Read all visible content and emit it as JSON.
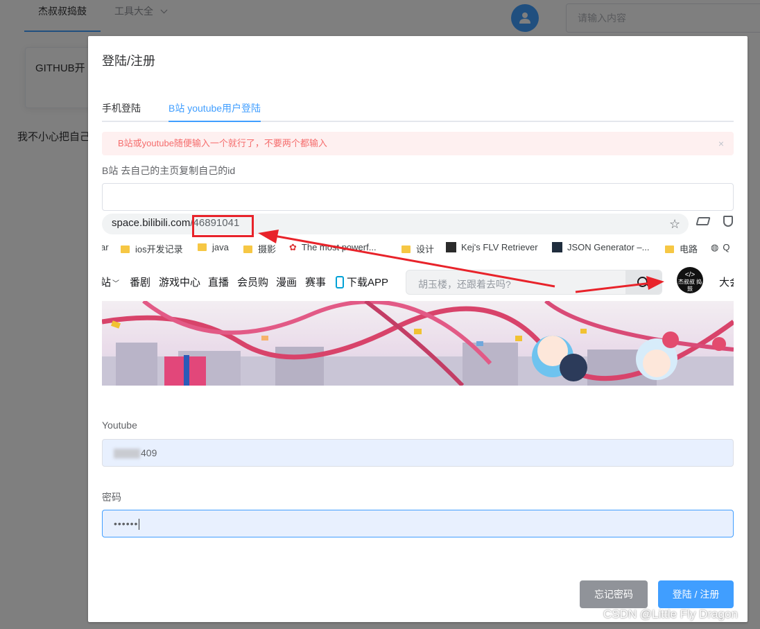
{
  "background": {
    "nav": {
      "home": "杰叔叔捣鼓",
      "tools": "工具大全"
    },
    "search_placeholder": "请输入内容",
    "card_title": "GITHUB开",
    "text": "我不小心把自己"
  },
  "dialog": {
    "title": "登陆/注册",
    "tabs": [
      {
        "label": "手机登陆",
        "active": false
      },
      {
        "label": "B站 youtube用户登陆",
        "active": true
      }
    ],
    "alert": {
      "text": "B站或youtube随便输入一个就行了，不要两个都输入",
      "close": "×"
    },
    "bili": {
      "label": "B站 去自己的主页复制自己的id",
      "value": ""
    },
    "youtube": {
      "label": "Youtube",
      "value_suffix": "409"
    },
    "password": {
      "label": "密码",
      "value": "••••••"
    },
    "buttons": {
      "forgot": "忘记密码",
      "login": "登陆 / 注册"
    }
  },
  "screenshot": {
    "url_host": "space.bilibili.com",
    "url_path": "/46891041",
    "bookmarks": [
      {
        "label": "ar",
        "icon": "none"
      },
      {
        "label": "ios开发记录",
        "icon": "folder"
      },
      {
        "label": "java",
        "icon": "folder"
      },
      {
        "label": "摄影",
        "icon": "folder"
      },
      {
        "label": "The most powerf...",
        "icon": "gear"
      },
      {
        "label": "设计",
        "icon": "folder"
      },
      {
        "label": "Kej's FLV Retriever",
        "icon": "square"
      },
      {
        "label": "JSON Generator –...",
        "icon": "square"
      },
      {
        "label": "电路",
        "icon": "folder"
      },
      {
        "label": "Q",
        "icon": "globe"
      }
    ],
    "bili_nav": [
      "站",
      "番剧",
      "游戏中心",
      "直播",
      "会员购",
      "漫画",
      "赛事",
      "下载APP"
    ],
    "search_placeholder": "胡玉楼，还跟着去吗?",
    "avatar_text": "杰叔叔 捣鼓",
    "more": "大会"
  },
  "watermark": "CSDN @Little Fly Dragon",
  "colors": {
    "primary": "#409eff",
    "danger": "#f56c6c",
    "alert_bg": "#fef0f0",
    "highlight": "#e8232a"
  }
}
